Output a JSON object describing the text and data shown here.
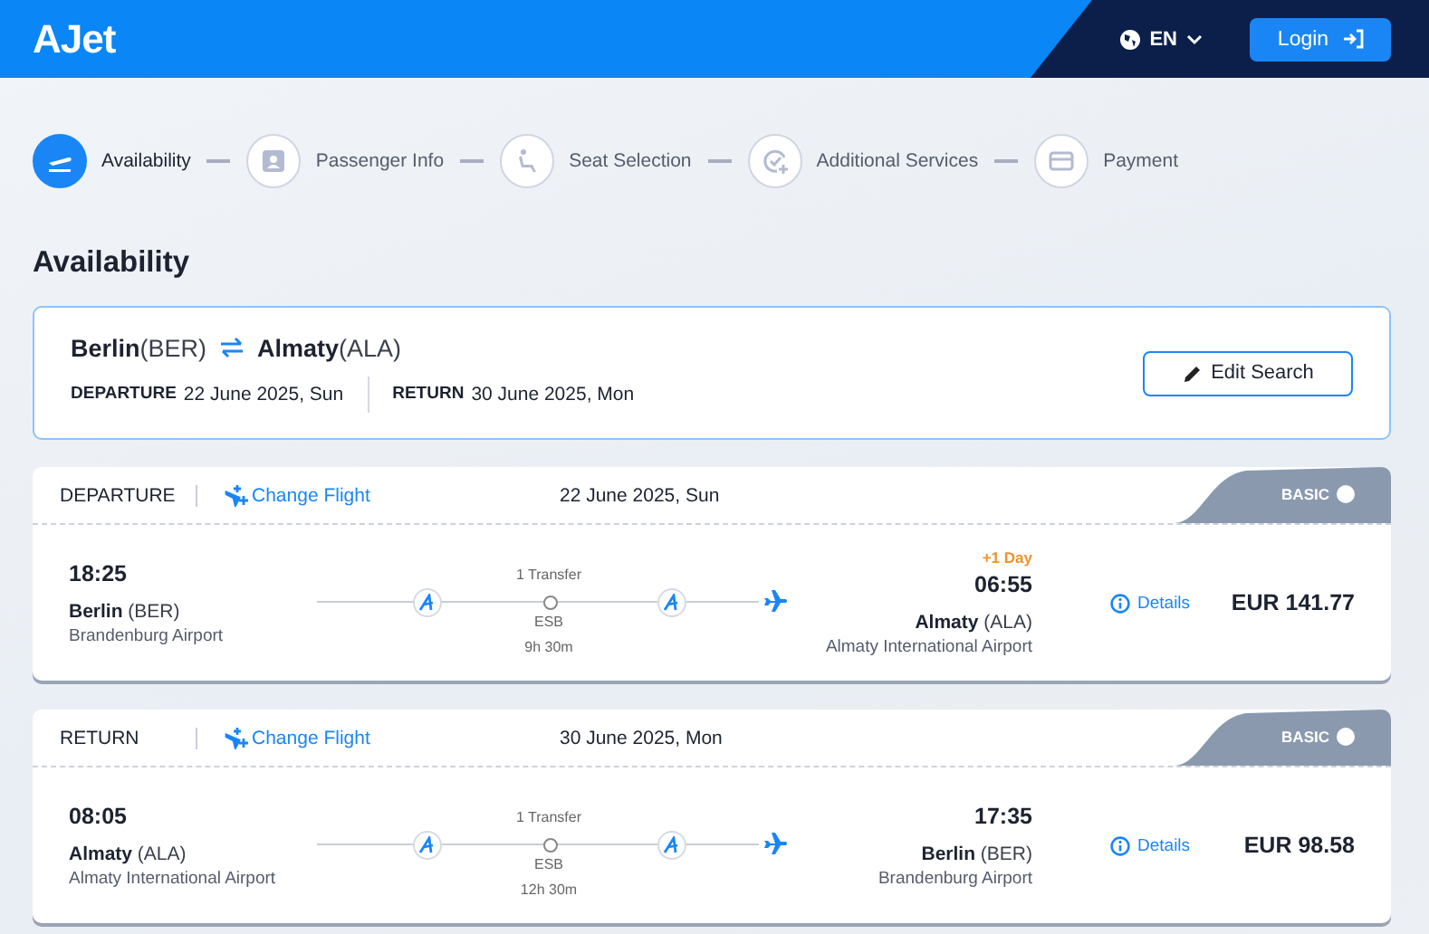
{
  "header": {
    "logo": "AJet",
    "language": "EN",
    "login": "Login"
  },
  "steps": [
    {
      "label": "Availability",
      "selected": true
    },
    {
      "label": "Passenger Info",
      "selected": false
    },
    {
      "label": "Seat Selection",
      "selected": false
    },
    {
      "label": "Additional Services",
      "selected": false
    },
    {
      "label": "Payment",
      "selected": false
    }
  ],
  "title": "Availability",
  "search": {
    "origin": "Berlin",
    "origin_code": "(BER)",
    "destination": "Almaty",
    "destination_code": "(ALA)",
    "departure_label": "DEPARTURE",
    "departure_date": "22 June 2025, Sun",
    "return_label": "RETURN",
    "return_date": "30 June 2025, Mon",
    "edit": "Edit Search"
  },
  "flights": [
    {
      "label": "DEPARTURE",
      "change": "Change Flight",
      "date": "22 June 2025, Sun",
      "fare": "BASIC",
      "dep_time": "18:25",
      "dep_city": "Berlin",
      "dep_code": "(BER)",
      "dep_airport": "Brandenburg Airport",
      "transfers": "1 Transfer",
      "stop": "ESB",
      "duration": "9h 30m",
      "day_note": "+1 Day",
      "arr_time": "06:55",
      "arr_city": "Almaty",
      "arr_code": "(ALA)",
      "arr_airport": "Almaty International Airport",
      "details": "Details",
      "price": "EUR 141.77"
    },
    {
      "label": "RETURN",
      "change": "Change Flight",
      "date": "30 June 2025, Mon",
      "fare": "BASIC",
      "dep_time": "08:05",
      "dep_city": "Almaty",
      "dep_code": "(ALA)",
      "dep_airport": "Almaty International Airport",
      "transfers": "1 Transfer",
      "stop": "ESB",
      "duration": "12h 30m",
      "arr_time": "17:35",
      "arr_city": "Berlin",
      "arr_code": "(BER)",
      "arr_airport": "Brandenburg Airport",
      "details": "Details",
      "price": "EUR 98.58"
    }
  ]
}
